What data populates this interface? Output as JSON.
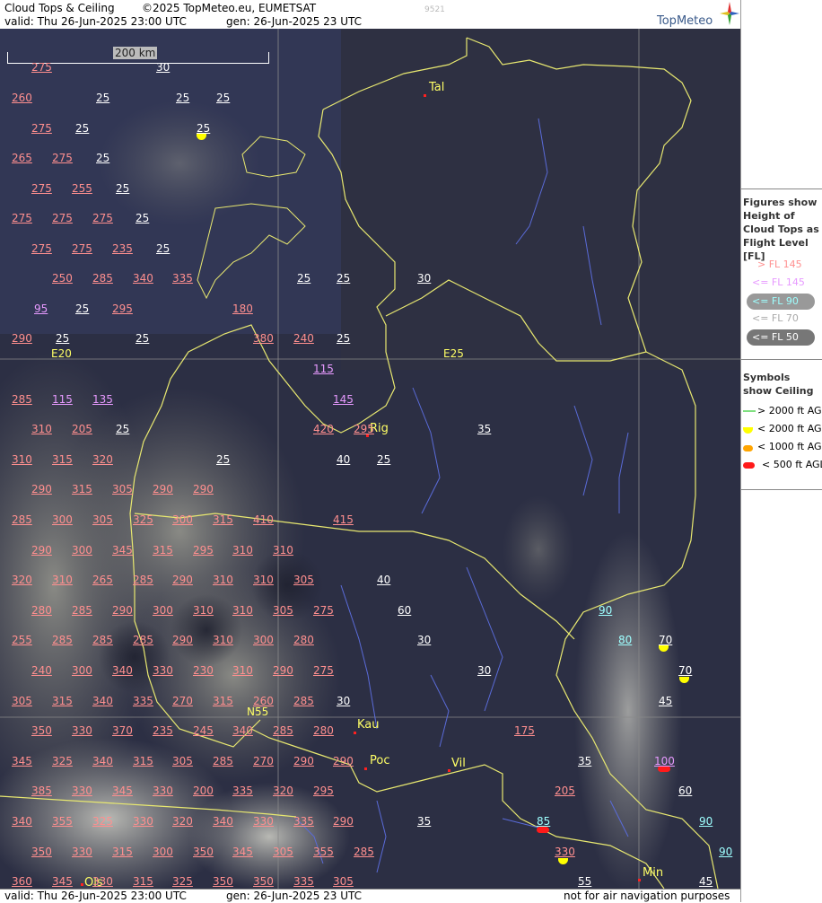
{
  "header": {
    "title": "Cloud Tops & Ceiling",
    "copyright": "©2025 TopMeteo.eu, EUMETSAT",
    "code": "9521",
    "valid": "valid:  Thu  26-Jun-2025  23:00 UTC",
    "gen": "gen: 26-Jun-2025 23 UTC",
    "logo": "TopMeteo"
  },
  "footer": {
    "valid": "valid:  Thu  26-Jun-2025  23:00 UTC",
    "gen": "gen: 26-Jun-2025 23 UTC",
    "disclaimer": "not for air navigation purposes"
  },
  "scale": {
    "label": "200 km"
  },
  "grid": {
    "e20": "E20",
    "e25": "E25",
    "n55": "N55"
  },
  "cities": [
    {
      "name": "Tal"
    },
    {
      "name": "Rig"
    },
    {
      "name": "Kau"
    },
    {
      "name": "Poc"
    },
    {
      "name": "Vil"
    },
    {
      "name": "Min"
    },
    {
      "name": "Ols"
    }
  ],
  "labels": [
    {
      "t": "275",
      "c": "hi"
    },
    {
      "t": "30",
      "c": "wh"
    },
    {
      "t": "260",
      "c": "hi"
    },
    {
      "t": "25",
      "c": "wh"
    },
    {
      "t": "25",
      "c": "wh"
    },
    {
      "t": "25",
      "c": "wh"
    },
    {
      "t": "275",
      "c": "hi"
    },
    {
      "t": "25",
      "c": "wh"
    },
    {
      "t": "25",
      "c": "wh"
    },
    {
      "t": "265",
      "c": "hi"
    },
    {
      "t": "275",
      "c": "hi"
    },
    {
      "t": "25",
      "c": "wh"
    },
    {
      "t": "275",
      "c": "hi"
    },
    {
      "t": "255",
      "c": "hi"
    },
    {
      "t": "25",
      "c": "wh"
    },
    {
      "t": "275",
      "c": "hi"
    },
    {
      "t": "275",
      "c": "hi"
    },
    {
      "t": "275",
      "c": "hi"
    },
    {
      "t": "25",
      "c": "wh"
    },
    {
      "t": "275",
      "c": "hi"
    },
    {
      "t": "275",
      "c": "hi"
    },
    {
      "t": "235",
      "c": "hi"
    },
    {
      "t": "25",
      "c": "wh"
    },
    {
      "t": "250",
      "c": "hi"
    },
    {
      "t": "285",
      "c": "hi"
    },
    {
      "t": "340",
      "c": "hi"
    },
    {
      "t": "335",
      "c": "hi"
    },
    {
      "t": "25",
      "c": "wh"
    },
    {
      "t": "25",
      "c": "wh"
    },
    {
      "t": "30",
      "c": "wh"
    },
    {
      "t": "95",
      "c": "mid"
    },
    {
      "t": "25",
      "c": "wh"
    },
    {
      "t": "295",
      "c": "hi"
    },
    {
      "t": "180",
      "c": "hi"
    },
    {
      "t": "290",
      "c": "hi"
    },
    {
      "t": "25",
      "c": "wh"
    },
    {
      "t": "25",
      "c": "wh"
    },
    {
      "t": "380",
      "c": "hi"
    },
    {
      "t": "240",
      "c": "hi"
    },
    {
      "t": "25",
      "c": "wh"
    },
    {
      "t": "115",
      "c": "mid"
    },
    {
      "t": "285",
      "c": "hi"
    },
    {
      "t": "115",
      "c": "mid"
    },
    {
      "t": "135",
      "c": "mid"
    },
    {
      "t": "145",
      "c": "mid"
    },
    {
      "t": "310",
      "c": "hi"
    },
    {
      "t": "205",
      "c": "hi"
    },
    {
      "t": "25",
      "c": "wh"
    },
    {
      "t": "420",
      "c": "hi"
    },
    {
      "t": "295",
      "c": "hi"
    },
    {
      "t": "35",
      "c": "wh"
    },
    {
      "t": "310",
      "c": "hi"
    },
    {
      "t": "315",
      "c": "hi"
    },
    {
      "t": "320",
      "c": "hi"
    },
    {
      "t": "25",
      "c": "wh"
    },
    {
      "t": "40",
      "c": "wh"
    },
    {
      "t": "25",
      "c": "wh"
    },
    {
      "t": "290",
      "c": "hi"
    },
    {
      "t": "315",
      "c": "hi"
    },
    {
      "t": "305",
      "c": "hi"
    },
    {
      "t": "290",
      "c": "hi"
    },
    {
      "t": "290",
      "c": "hi"
    },
    {
      "t": "285",
      "c": "hi"
    },
    {
      "t": "300",
      "c": "hi"
    },
    {
      "t": "305",
      "c": "hi"
    },
    {
      "t": "325",
      "c": "hi"
    },
    {
      "t": "300",
      "c": "hi"
    },
    {
      "t": "315",
      "c": "hi"
    },
    {
      "t": "410",
      "c": "hi"
    },
    {
      "t": "415",
      "c": "hi"
    },
    {
      "t": "290",
      "c": "hi"
    },
    {
      "t": "300",
      "c": "hi"
    },
    {
      "t": "345",
      "c": "hi"
    },
    {
      "t": "315",
      "c": "hi"
    },
    {
      "t": "295",
      "c": "hi"
    },
    {
      "t": "310",
      "c": "hi"
    },
    {
      "t": "310",
      "c": "hi"
    },
    {
      "t": "320",
      "c": "hi"
    },
    {
      "t": "310",
      "c": "hi"
    },
    {
      "t": "265",
      "c": "hi"
    },
    {
      "t": "285",
      "c": "hi"
    },
    {
      "t": "290",
      "c": "hi"
    },
    {
      "t": "310",
      "c": "hi"
    },
    {
      "t": "310",
      "c": "hi"
    },
    {
      "t": "305",
      "c": "hi"
    },
    {
      "t": "40",
      "c": "wh"
    },
    {
      "t": "280",
      "c": "hi"
    },
    {
      "t": "285",
      "c": "hi"
    },
    {
      "t": "290",
      "c": "hi"
    },
    {
      "t": "300",
      "c": "hi"
    },
    {
      "t": "310",
      "c": "hi"
    },
    {
      "t": "310",
      "c": "hi"
    },
    {
      "t": "305",
      "c": "hi"
    },
    {
      "t": "275",
      "c": "hi"
    },
    {
      "t": "60",
      "c": "wh"
    },
    {
      "t": "90",
      "c": "low"
    },
    {
      "t": "255",
      "c": "hi"
    },
    {
      "t": "285",
      "c": "hi"
    },
    {
      "t": "285",
      "c": "hi"
    },
    {
      "t": "285",
      "c": "hi"
    },
    {
      "t": "290",
      "c": "hi"
    },
    {
      "t": "310",
      "c": "hi"
    },
    {
      "t": "300",
      "c": "hi"
    },
    {
      "t": "280",
      "c": "hi"
    },
    {
      "t": "30",
      "c": "wh"
    },
    {
      "t": "80",
      "c": "low"
    },
    {
      "t": "70",
      "c": "wh"
    },
    {
      "t": "240",
      "c": "hi"
    },
    {
      "t": "300",
      "c": "hi"
    },
    {
      "t": "340",
      "c": "hi"
    },
    {
      "t": "330",
      "c": "hi"
    },
    {
      "t": "230",
      "c": "hi"
    },
    {
      "t": "310",
      "c": "hi"
    },
    {
      "t": "290",
      "c": "hi"
    },
    {
      "t": "275",
      "c": "hi"
    },
    {
      "t": "30",
      "c": "wh"
    },
    {
      "t": "70",
      "c": "wh"
    },
    {
      "t": "305",
      "c": "hi"
    },
    {
      "t": "315",
      "c": "hi"
    },
    {
      "t": "340",
      "c": "hi"
    },
    {
      "t": "335",
      "c": "hi"
    },
    {
      "t": "270",
      "c": "hi"
    },
    {
      "t": "315",
      "c": "hi"
    },
    {
      "t": "260",
      "c": "hi"
    },
    {
      "t": "285",
      "c": "hi"
    },
    {
      "t": "30",
      "c": "wh"
    },
    {
      "t": "45",
      "c": "wh"
    },
    {
      "t": "350",
      "c": "hi"
    },
    {
      "t": "330",
      "c": "hi"
    },
    {
      "t": "370",
      "c": "hi"
    },
    {
      "t": "235",
      "c": "hi"
    },
    {
      "t": "245",
      "c": "hi"
    },
    {
      "t": "340",
      "c": "hi"
    },
    {
      "t": "285",
      "c": "hi"
    },
    {
      "t": "280",
      "c": "hi"
    },
    {
      "t": "175",
      "c": "hi"
    },
    {
      "t": "345",
      "c": "hi"
    },
    {
      "t": "325",
      "c": "hi"
    },
    {
      "t": "340",
      "c": "hi"
    },
    {
      "t": "315",
      "c": "hi"
    },
    {
      "t": "305",
      "c": "hi"
    },
    {
      "t": "285",
      "c": "hi"
    },
    {
      "t": "270",
      "c": "hi"
    },
    {
      "t": "290",
      "c": "hi"
    },
    {
      "t": "290",
      "c": "hi"
    },
    {
      "t": "35",
      "c": "wh"
    },
    {
      "t": "100",
      "c": "mid"
    },
    {
      "t": "385",
      "c": "hi"
    },
    {
      "t": "330",
      "c": "hi"
    },
    {
      "t": "345",
      "c": "hi"
    },
    {
      "t": "330",
      "c": "hi"
    },
    {
      "t": "200",
      "c": "hi"
    },
    {
      "t": "335",
      "c": "hi"
    },
    {
      "t": "320",
      "c": "hi"
    },
    {
      "t": "295",
      "c": "hi"
    },
    {
      "t": "205",
      "c": "hi"
    },
    {
      "t": "60",
      "c": "wh"
    },
    {
      "t": "340",
      "c": "hi"
    },
    {
      "t": "355",
      "c": "hi"
    },
    {
      "t": "325",
      "c": "hi"
    },
    {
      "t": "330",
      "c": "hi"
    },
    {
      "t": "320",
      "c": "hi"
    },
    {
      "t": "340",
      "c": "hi"
    },
    {
      "t": "330",
      "c": "hi"
    },
    {
      "t": "335",
      "c": "hi"
    },
    {
      "t": "290",
      "c": "hi"
    },
    {
      "t": "35",
      "c": "wh"
    },
    {
      "t": "85",
      "c": "low"
    },
    {
      "t": "90",
      "c": "low"
    },
    {
      "t": "350",
      "c": "hi"
    },
    {
      "t": "330",
      "c": "hi"
    },
    {
      "t": "315",
      "c": "hi"
    },
    {
      "t": "300",
      "c": "hi"
    },
    {
      "t": "350",
      "c": "hi"
    },
    {
      "t": "345",
      "c": "hi"
    },
    {
      "t": "305",
      "c": "hi"
    },
    {
      "t": "355",
      "c": "hi"
    },
    {
      "t": "285",
      "c": "hi"
    },
    {
      "t": "330",
      "c": "hi"
    },
    {
      "t": "90",
      "c": "low"
    },
    {
      "t": "360",
      "c": "hi"
    },
    {
      "t": "345",
      "c": "hi"
    },
    {
      "t": "330",
      "c": "hi"
    },
    {
      "t": "315",
      "c": "hi"
    },
    {
      "t": "325",
      "c": "hi"
    },
    {
      "t": "350",
      "c": "hi"
    },
    {
      "t": "350",
      "c": "hi"
    },
    {
      "t": "335",
      "c": "hi"
    },
    {
      "t": "305",
      "c": "hi"
    },
    {
      "t": "55",
      "c": "wh"
    },
    {
      "t": "45",
      "c": "wh"
    }
  ],
  "legend": {
    "figures_title": "Figures show Height of Cloud Tops as Flight Level  [FL]",
    "items": [
      {
        "text": "> FL 145",
        "color": "#ff8f8f"
      },
      {
        "text": "<= FL 145",
        "color": "#e79aff"
      },
      {
        "text": "<= FL 90",
        "color": "#9effff"
      },
      {
        "text": "<= FL 70",
        "color": "#aaaaaa"
      },
      {
        "text": "<= FL 50",
        "color": "#ffffff"
      }
    ],
    "symbols_title": "Symbols show Ceiling",
    "symbols": [
      {
        "text": "> 2000 ft AGL",
        "color": "#7fe07f"
      },
      {
        "text": "< 2000 ft AGL",
        "color": "#ffff00"
      },
      {
        "text": "< 1000 ft AGL",
        "color": "#ffa500"
      },
      {
        "text": "< 500 ft AGL",
        "color": "#ff1a1a"
      }
    ]
  }
}
